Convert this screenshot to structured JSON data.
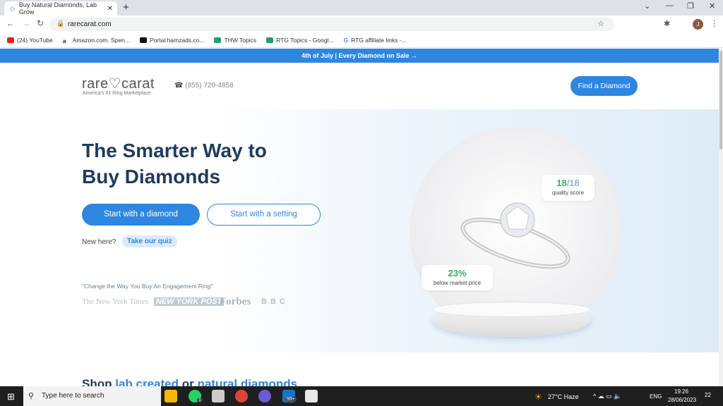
{
  "browser": {
    "tab_title": "Buy Natural Diamonds, Lab Grow",
    "url": "rarecarat.com",
    "bookmarks": [
      {
        "label": "(24) YouTube",
        "color": "#e62117"
      },
      {
        "label": "Amazon.com. Spen...",
        "color": "#222"
      },
      {
        "label": "Portal.hamzads.co...",
        "color": "#111"
      },
      {
        "label": "THW Topics",
        "color": "#1ea362"
      },
      {
        "label": "RTG Topics - Googl...",
        "color": "#1ea362"
      },
      {
        "label": "RTG affiliate links -...",
        "color": "#4285f4"
      }
    ],
    "profile_initial": "J"
  },
  "banner": "4th of July | Every Diamond on Sale →",
  "header": {
    "logo": "rare♡carat",
    "tagline": "America's #1 Ring Marketplace",
    "phone": "(855) 720-4858",
    "cta": "Find a Diamond"
  },
  "hero": {
    "title": "The Smarter Way to Buy Diamonds",
    "primary": "Start with a diamond",
    "secondary": "Start with a setting",
    "new_here": "New here?",
    "quiz": "Take our quiz",
    "quote": "\"Change the Way You Buy An Engagement Ring\"",
    "press": [
      "The New York Times",
      "NEW YORK POST",
      "Forbes",
      "BBC"
    ],
    "quality_score": "18",
    "quality_max": "/18",
    "quality_label": "quality score",
    "discount": "23%",
    "discount_label": "below market price"
  },
  "shop": {
    "prefix": "Shop ",
    "lab": "lab created",
    "or": " or ",
    "natural": "natural diamonds"
  },
  "taskbar": {
    "search_placeholder": "Type here to search",
    "weather": "27°C  Haze",
    "lang": "ENG",
    "time": "19:26",
    "date": "28/06/2023",
    "notifications": "22",
    "mail_badge": "99+",
    "whatsapp_badge": "1"
  },
  "colors": {
    "brand": "#2d86e0",
    "heading": "#1f3a5f",
    "green": "#2fb35a"
  }
}
